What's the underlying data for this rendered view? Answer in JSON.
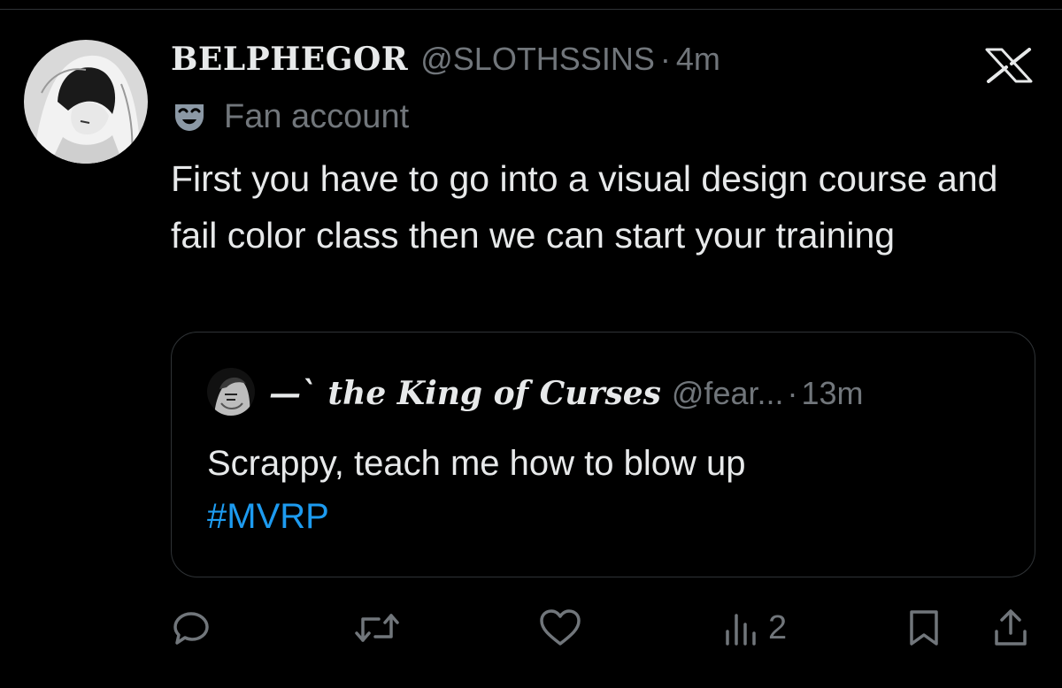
{
  "tweet": {
    "author": {
      "display_name": "BELPHEGOR",
      "handle": "@SLOTHSSINS",
      "avatar_icon": "avatar-portrait"
    },
    "separator": "·",
    "time_ago": "4m",
    "label": {
      "icon": "theater-mask-icon",
      "text": "Fan account"
    },
    "text": "First you have to go into a visual design course and fail color class then we can start your training"
  },
  "quote": {
    "author": {
      "display_name": "—` 𝒕𝒉𝒆 𝑲𝒊𝒏𝒈 𝒐𝒇 𝑪𝒖𝒓𝒔𝒆𝒔",
      "handle": "@fear...",
      "avatar_icon": "avatar-portrait"
    },
    "separator": "·",
    "time_ago": "13m",
    "text": "Scrappy, teach me how to blow up",
    "hashtag": "#MVRP"
  },
  "actions": {
    "reply_icon": "reply-icon",
    "retweet_icon": "retweet-icon",
    "like_icon": "heart-icon",
    "views_icon": "views-icon",
    "views_count": "2",
    "bookmark_icon": "bookmark-icon",
    "share_icon": "share-icon"
  },
  "colors": {
    "background": "#000000",
    "text_primary": "#e7e9ea",
    "text_secondary": "#71767b",
    "border": "#2f3336",
    "accent": "#1d9bf0"
  }
}
